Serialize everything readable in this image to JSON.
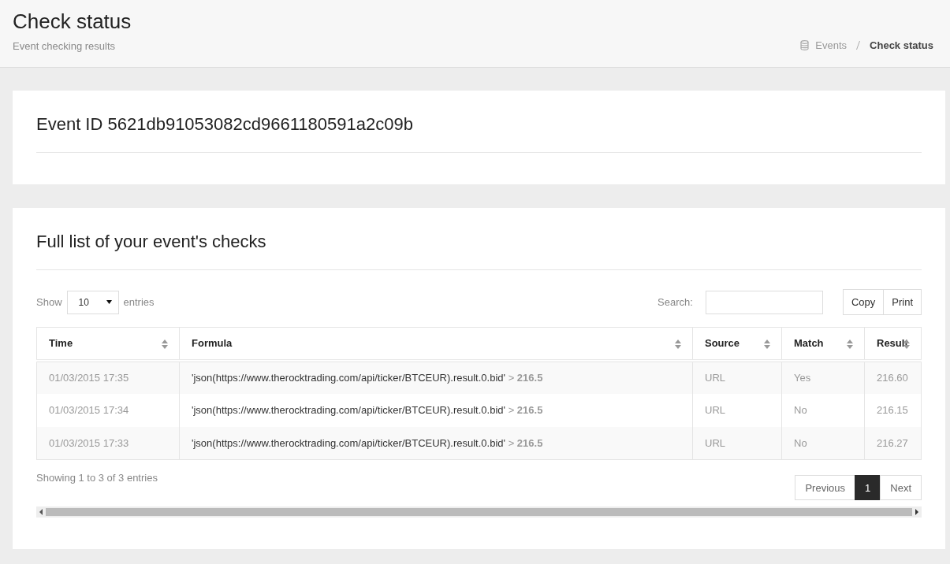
{
  "header": {
    "title": "Check status",
    "subtitle": "Event checking results"
  },
  "breadcrumb": [
    {
      "label": "Events",
      "current": false
    },
    {
      "label": "Check status",
      "current": true
    }
  ],
  "event_card": {
    "title": "Event ID 5621db91053082cd9661180591a2c09b"
  },
  "checks_card": {
    "title": "Full list of your event's checks",
    "length_menu": {
      "before": "Show",
      "value": "10",
      "after": "entries"
    },
    "search": {
      "label": "Search:"
    },
    "buttons": [
      "Copy",
      "Print"
    ],
    "table": {
      "columns": [
        "Time",
        "Formula",
        "Source",
        "Match",
        "Result"
      ],
      "rows": [
        {
          "time": "01/03/2015 17:35",
          "formula": {
            "expression": "'json(https://www.therocktrading.com/api/ticker/BTCEUR).result.0.bid'",
            "operator": ">",
            "threshold": "216.5"
          },
          "source": "URL",
          "match": "Yes",
          "result": "216.60"
        },
        {
          "time": "01/03/2015 17:34",
          "formula": {
            "expression": "'json(https://www.therocktrading.com/api/ticker/BTCEUR).result.0.bid'",
            "operator": ">",
            "threshold": "216.5"
          },
          "source": "URL",
          "match": "No",
          "result": "216.15"
        },
        {
          "time": "01/03/2015 17:33",
          "formula": {
            "expression": "'json(https://www.therocktrading.com/api/ticker/BTCEUR).result.0.bid'",
            "operator": ">",
            "threshold": "216.5"
          },
          "source": "URL",
          "match": "No",
          "result": "216.27"
        }
      ]
    },
    "info": "Showing 1 to 3 of 3 entries",
    "pagination": [
      {
        "label": "Previous",
        "selected": false
      },
      {
        "label": "1",
        "selected": true
      },
      {
        "label": "Next",
        "selected": false
      }
    ]
  }
}
